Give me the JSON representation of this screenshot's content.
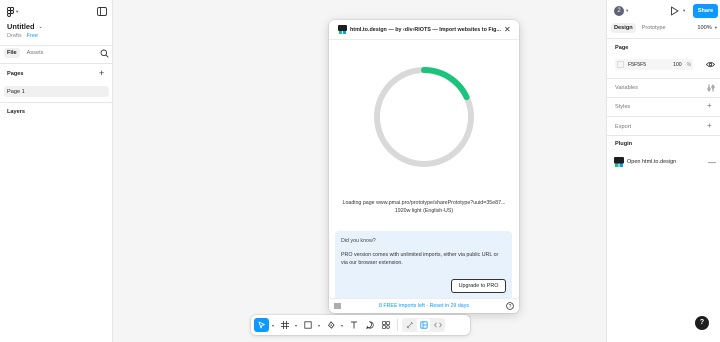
{
  "left_panel": {
    "file_name": "Untitled",
    "location": "Drafts",
    "plan_badge": "Free",
    "tabs": [
      "File",
      "Assets"
    ],
    "pages_title": "Pages",
    "pages": [
      "Page 1"
    ],
    "layers_title": "Layers"
  },
  "right_panel": {
    "avatar_initial": "2",
    "share_label": "Share",
    "tabs": [
      "Design",
      "Prototype"
    ],
    "zoom": "100%",
    "page_section": "Page",
    "page_color": "F5F5F5",
    "page_opacity": "100",
    "page_opacity_unit": "%",
    "variables_label": "Variables",
    "styles_label": "Styles",
    "export_label": "Export",
    "plugin_section": "Plugin",
    "plugin_name": "Open html.to.design",
    "help_label": "?"
  },
  "plugin_dialog": {
    "title": "html.to.design — by ‹div›RIOTS — Import websites to Fig...",
    "progress": 0.18,
    "progress_color": "#1bc47d",
    "track_color": "#d9d9d9",
    "loading_line1": "Loading page www.pmai.pro/prototype/sharePrototype?uuid=35e87...",
    "loading_line2": "1920w light (English-US)",
    "know_title": "Did you know?",
    "know_body": "PRO version comes with unlimited imports, either via public URL or via our browser extension.",
    "upgrade_label": "Upgrade to PRO",
    "footer_text": "8 FREE imports left · Reset in 29 days"
  },
  "toolbar": {
    "tools": [
      "move-tool",
      "frame-tool",
      "shape-tool",
      "pen-tool",
      "text-tool",
      "comment-tool",
      "actions-tool"
    ],
    "modes": [
      "draw-mode",
      "design-mode",
      "dev-mode"
    ],
    "accent": "#0d99ff"
  }
}
